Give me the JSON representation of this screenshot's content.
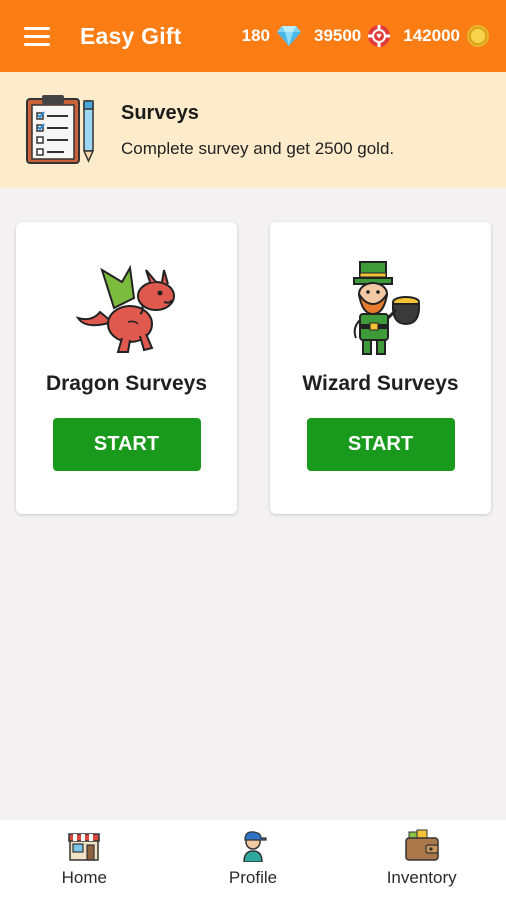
{
  "app": {
    "title": "Easy Gift",
    "menu_icon": "hamburger-menu-icon",
    "colors": {
      "appbar": "#fc7d13",
      "banner": "#fdeccb",
      "start_button": "#1a9a1c"
    }
  },
  "currencies": [
    {
      "value": "180",
      "icon": "diamond-icon"
    },
    {
      "value": "39500",
      "icon": "poker-chip-icon"
    },
    {
      "value": "142000",
      "icon": "gold-coin-icon"
    }
  ],
  "banner": {
    "icon": "clipboard-survey-icon",
    "title": "Surveys",
    "subtitle": "Complete survey and get 2500 gold."
  },
  "cards": [
    {
      "icon": "dragon-icon",
      "title": "Dragon Surveys",
      "button": "START"
    },
    {
      "icon": "leprechaun-wizard-icon",
      "title": "Wizard Surveys",
      "button": "START"
    }
  ],
  "nav": [
    {
      "label": "Home",
      "icon": "shop-home-icon"
    },
    {
      "label": "Profile",
      "icon": "profile-avatar-icon"
    },
    {
      "label": "Inventory",
      "icon": "wallet-inventory-icon"
    }
  ]
}
